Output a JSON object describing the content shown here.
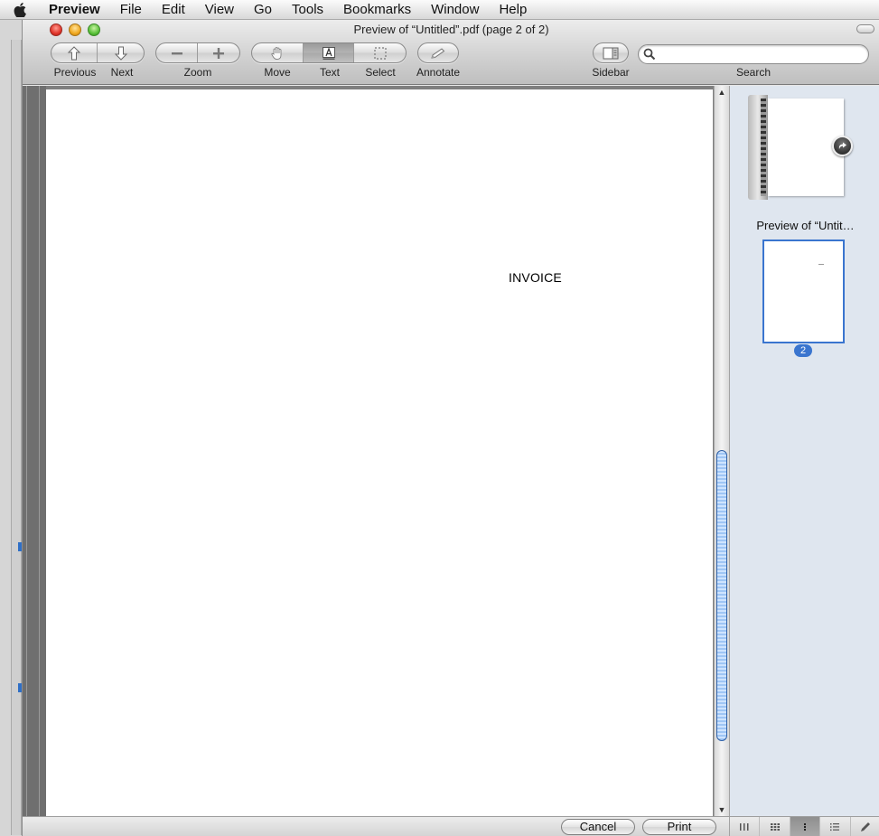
{
  "menubar": {
    "app": "Preview",
    "items": [
      "File",
      "Edit",
      "View",
      "Go",
      "Tools",
      "Bookmarks",
      "Window",
      "Help"
    ]
  },
  "window": {
    "title": "Preview of “Untitled”.pdf (page 2 of 2)"
  },
  "toolbar": {
    "previous": "Previous",
    "next": "Next",
    "zoom": "Zoom",
    "move": "Move",
    "text": "Text",
    "select": "Select",
    "annotate": "Annotate",
    "sidebar": "Sidebar",
    "search": "Search",
    "search_value": ""
  },
  "document": {
    "text": "INVOICE"
  },
  "sidebar": {
    "thumb1_label": "Preview of “Untit…",
    "thumb2_badge": "2"
  },
  "bottom": {
    "cancel": "Cancel",
    "print": "Print"
  },
  "colors": {
    "selection": "#3a75cf",
    "sidebar_bg": "#dfe6ef"
  }
}
